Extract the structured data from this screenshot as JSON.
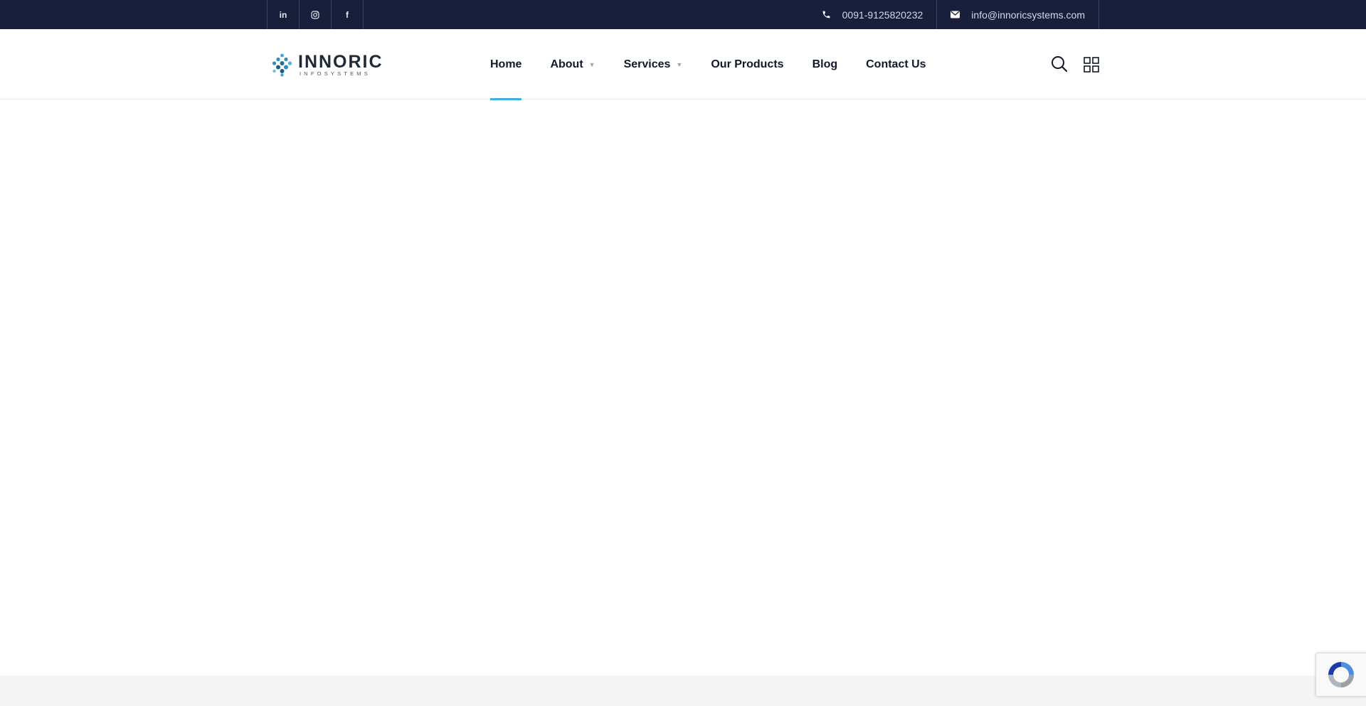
{
  "topbar": {
    "social": [
      {
        "icon": "linkedin-icon",
        "glyph": "in"
      },
      {
        "icon": "instagram-icon",
        "glyph": ""
      },
      {
        "icon": "facebook-icon",
        "glyph": "f"
      }
    ],
    "phone": "0091-9125820232",
    "email": "info@innoricsystems.com",
    "background": "#171f3b"
  },
  "header": {
    "logo": {
      "word": "INNORIC",
      "sub": "INFOSYSTEMS"
    },
    "nav": [
      {
        "label": "Home",
        "active": true,
        "has_dropdown": false
      },
      {
        "label": "About",
        "active": false,
        "has_dropdown": true
      },
      {
        "label": "Services",
        "active": false,
        "has_dropdown": true
      },
      {
        "label": "Our Products",
        "active": false,
        "has_dropdown": false
      },
      {
        "label": "Blog",
        "active": false,
        "has_dropdown": false
      },
      {
        "label": "Contact Us",
        "active": false,
        "has_dropdown": false
      }
    ],
    "accent": "#3db0e0",
    "icons": [
      "search-icon",
      "grid-menu-icon"
    ]
  },
  "caret_glyph": "▼",
  "recaptcha": {
    "icon": "recaptcha-icon"
  }
}
